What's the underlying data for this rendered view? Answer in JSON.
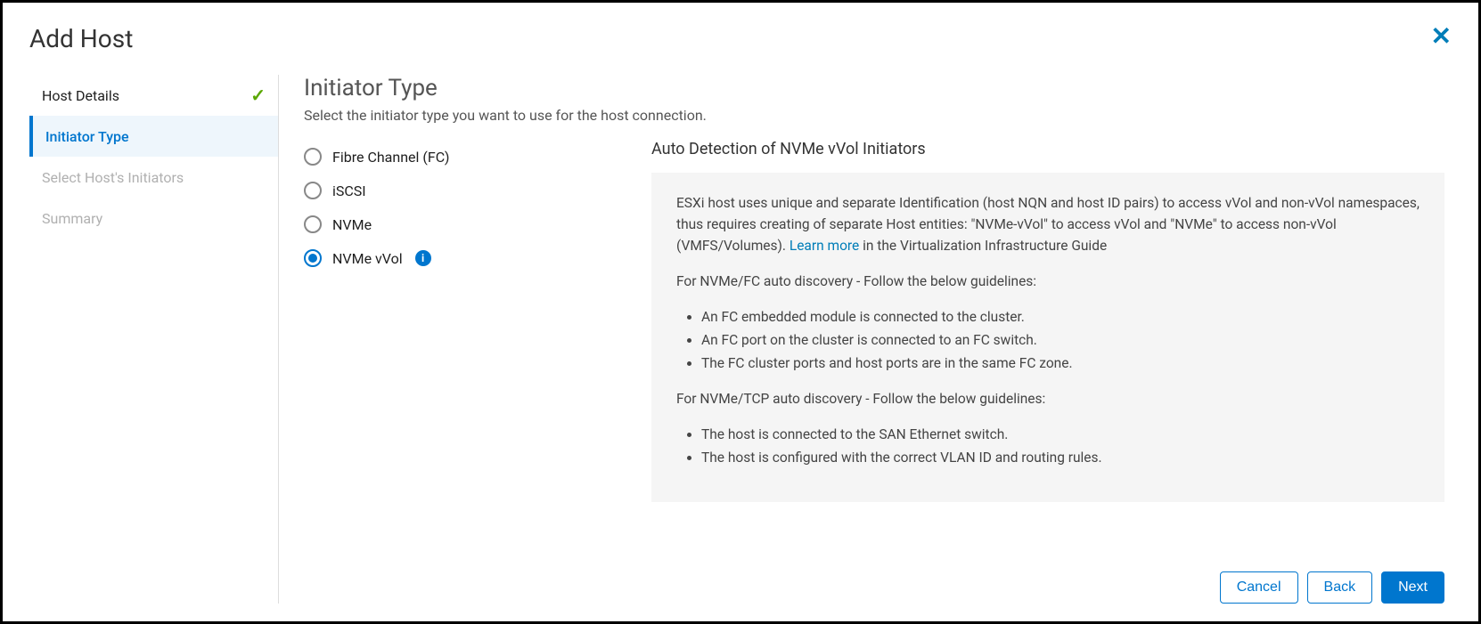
{
  "dialog": {
    "title": "Add Host"
  },
  "sidebar": {
    "items": [
      {
        "label": "Host Details",
        "state": "completed"
      },
      {
        "label": "Initiator Type",
        "state": "active"
      },
      {
        "label": "Select Host's Initiators",
        "state": "future"
      },
      {
        "label": "Summary",
        "state": "future"
      }
    ]
  },
  "main": {
    "heading": "Initiator Type",
    "sub": "Select the initiator type you want to use for the host connection.",
    "radios": [
      {
        "label": "Fibre Channel (FC)",
        "selected": false
      },
      {
        "label": "iSCSI",
        "selected": false
      },
      {
        "label": "NVMe",
        "selected": false
      },
      {
        "label": "NVMe vVol",
        "selected": true
      }
    ],
    "info": {
      "title": "Auto Detection of NVMe vVol Initiators",
      "para1_before": "ESXi host uses unique and separate Identification (host NQN and host ID pairs) to access vVol and non-vVol namespaces, thus requires creating of separate Host entities: \"NVMe-vVol\" to access vVol and \"NVMe\" to access non-vVol (VMFS/Volumes). ",
      "learn_more": "Learn more",
      "para1_after": " in the Virtualization Infrastructure Guide",
      "para2": "For NVMe/FC auto discovery - Follow the below guidelines:",
      "list1": [
        "An FC embedded module is connected to the cluster.",
        "An FC port on the cluster is connected to an FC switch.",
        "The FC cluster ports and host ports are in the same FC zone."
      ],
      "para3": "For NVMe/TCP auto discovery - Follow the below guidelines:",
      "list2": [
        "The host is connected to the SAN Ethernet switch.",
        "The host is configured with the correct VLAN ID and routing rules."
      ]
    }
  },
  "footer": {
    "cancel": "Cancel",
    "back": "Back",
    "next": "Next"
  },
  "icons": {
    "info_glyph": "i",
    "close_glyph": "✕",
    "check_glyph": "✓"
  }
}
